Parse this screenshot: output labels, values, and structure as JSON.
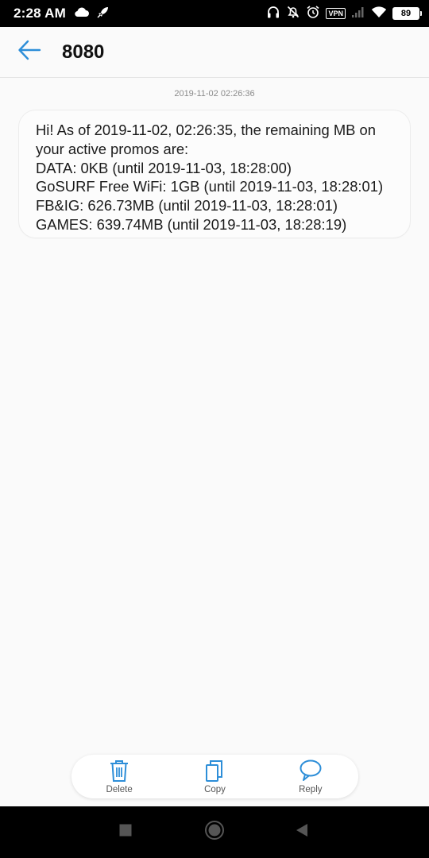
{
  "status_bar": {
    "time": "2:28 AM",
    "vpn_label": "VPN",
    "battery_level": "89",
    "icons": [
      "cloud-icon",
      "rocket-icon",
      "headphones-icon",
      "mute-bell-icon",
      "alarm-icon",
      "vpn-icon",
      "signal-icon",
      "wifi-icon",
      "battery-icon"
    ]
  },
  "header": {
    "title": "8080",
    "back_icon": "arrow-left-icon",
    "accent_color": "#2d8ed8"
  },
  "conversation": {
    "timestamp": "2019-11-02 02:26:36",
    "message_lines": [
      "Hi! As of 2019-11-02, 02:26:35, the remaining MB on",
      "your active promos are:",
      "DATA: 0KB (until 2019-11-03, 18:28:00)",
      "GoSURF Free WiFi: 1GB (until 2019-11-03, 18:28:01)",
      "FB&IG: 626.73MB (until 2019-11-03, 18:28:01)",
      "GAMES: 639.74MB (until 2019-11-03, 18:28:19)"
    ]
  },
  "actions": {
    "delete_label": "Delete",
    "copy_label": "Copy",
    "reply_label": "Reply",
    "icon_color": "#2d8ed8"
  },
  "nav": {
    "icons": [
      "recents-square-icon",
      "home-circle-icon",
      "back-triangle-icon"
    ]
  }
}
